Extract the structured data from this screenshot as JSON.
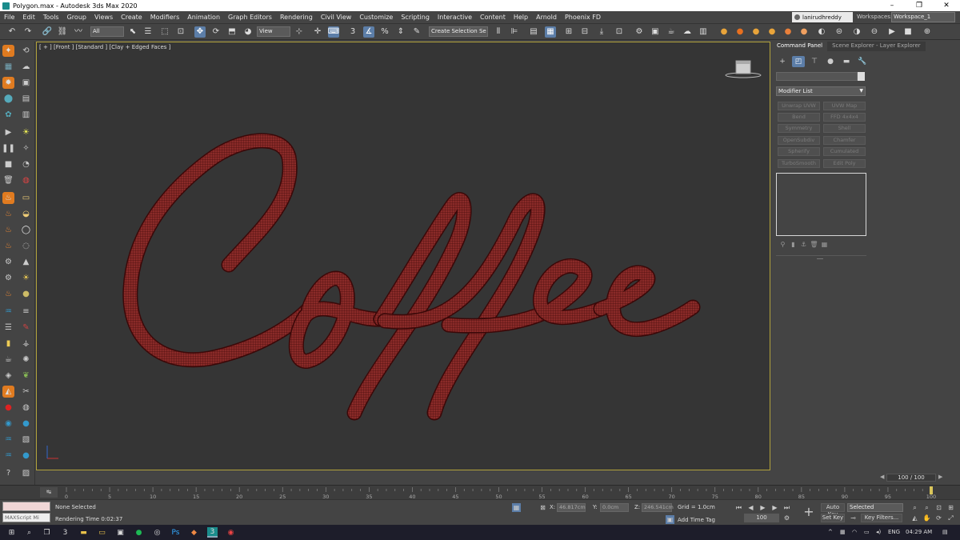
{
  "titlebar": {
    "title": "Polygon.max - Autodesk 3ds Max 2020",
    "minimize": "–",
    "restore": "❐",
    "close": "✕"
  },
  "menubar": {
    "items": [
      "File",
      "Edit",
      "Tools",
      "Group",
      "Views",
      "Create",
      "Modifiers",
      "Animation",
      "Graph Editors",
      "Rendering",
      "Civil View",
      "Customize",
      "Scripting",
      "Interactive",
      "Content",
      "Help",
      "Arnold",
      "Phoenix FD"
    ],
    "user": "lanirudhreddy",
    "workspaces_label": "Workspaces:",
    "workspace": "Workspace_1"
  },
  "toolbar": {
    "selection_filter": "All",
    "reference_coord": "View",
    "named_selection": "Create Selection Se"
  },
  "viewport": {
    "label": "[ + ] [Front ] [Standard ] [Clay + Edged Faces ]",
    "accent": "#b2a23b",
    "text_color": "#7a1a1c"
  },
  "command_panel": {
    "tabs": [
      "Command Panel",
      "Scene Explorer - Layer Explorer"
    ],
    "modifier_list": "Modifier List",
    "modifier_buttons": [
      [
        "Unwrap UVW",
        "UVW Map"
      ],
      [
        "Bend",
        "FFD 4x4x4"
      ],
      [
        "Symmetry",
        "Shell"
      ],
      [
        "OpenSubdiv",
        "Chamfer"
      ],
      [
        "Spherify",
        "Cumulated"
      ],
      [
        "TurboSmooth",
        "Edit Poly"
      ]
    ]
  },
  "timeline": {
    "slider_label": "100 / 100",
    "ticks": [
      0,
      5,
      10,
      15,
      20,
      25,
      30,
      35,
      40,
      45,
      50,
      55,
      60,
      65,
      70,
      75,
      80,
      85,
      90,
      95,
      100
    ]
  },
  "statusbar": {
    "maxscript": "MAXScript Mi",
    "selection": "None Selected",
    "render_time": "Rendering Time  0:02:37",
    "x_label": "X:",
    "x_value": "46.817cm",
    "y_label": "Y:",
    "y_value": "0.0cm",
    "z_label": "Z:",
    "z_value": "246.541cm",
    "grid": "Grid = 1.0cm",
    "add_time_tag": "Add Time Tag",
    "auto_key": "Auto Key",
    "selected": "Selected",
    "set_key": "Set Key",
    "key_filters": "Key Filters...",
    "frame": "100"
  },
  "taskbar": {
    "lang": "ENG",
    "time": "04:29 AM"
  }
}
